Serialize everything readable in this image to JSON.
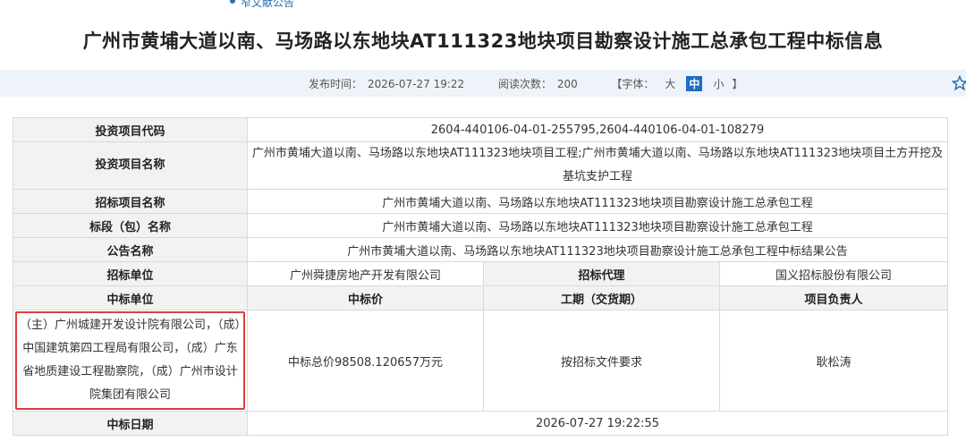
{
  "breadcrumb": "窄文献公告",
  "title": "广州市黄埔大道以南、马场路以东地块AT111323地块项目勘察设计施工总承包工程中标信息",
  "meta": {
    "publish_label": "发布时间：",
    "publish_time": "2026-07-27 19:22",
    "views_label": "阅读次数：",
    "views": "200",
    "font_open": "【字体：",
    "font_large": "大",
    "font_medium": "中",
    "font_small": "小",
    "font_close": "】"
  },
  "table": {
    "invest_code_label": "投资项目代码",
    "invest_code": "2604-440106-04-01-255795,2604-440106-04-01-108279",
    "invest_name_label": "投资项目名称",
    "invest_name": "广州市黄埔大道以南、马场路以东地块AT111323地块项目工程;广州市黄埔大道以南、马场路以东地块AT111323地块项目土方开挖及基坑支护工程",
    "bid_project_label": "招标项目名称",
    "bid_project": "广州市黄埔大道以南、马场路以东地块AT111323地块项目勘察设计施工总承包工程",
    "section_label": "标段（包）名称",
    "section": "广州市黄埔大道以南、马场路以东地块AT111323地块项目勘察设计施工总承包工程",
    "notice_label": "公告名称",
    "notice": "广州市黄埔大道以南、马场路以东地块AT111323地块项目勘察设计施工总承包工程中标结果公告",
    "tenderer_label": "招标单位",
    "tenderer": "广州舜捷房地产开发有限公司",
    "agent_label": "招标代理",
    "agent": "国义招标股份有限公司",
    "winner_label": "中标单位",
    "price_label": "中标价",
    "period_label": "工期（交货期）",
    "manager_label": "项目负责人",
    "winner": "（主）广州城建开发设计院有限公司，（成）中国建筑第四工程局有限公司，（成）广东省地质建设工程勘察院，（成）广州市设计院集团有限公司",
    "price": "中标总价98508.120657万元",
    "period": "按招标文件要求",
    "manager": "耿松涛",
    "date_label": "中标日期",
    "date": "2026-07-27 19:22:55"
  }
}
